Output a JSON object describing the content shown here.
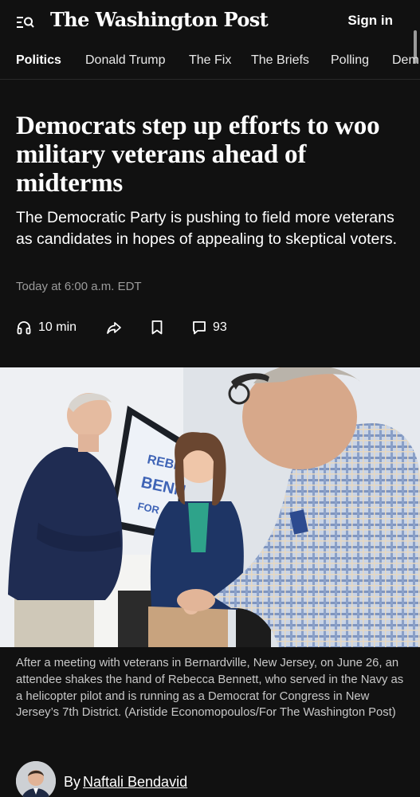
{
  "header": {
    "logo_text": "The Washington Post",
    "signin_label": "Sign in"
  },
  "nav": {
    "items": [
      {
        "label": "Politics",
        "active": true
      },
      {
        "label": "Donald Trump"
      },
      {
        "label": "The Fix"
      },
      {
        "label": "The Briefs"
      },
      {
        "label": "Polling"
      },
      {
        "label": "Dem"
      }
    ]
  },
  "article": {
    "headline": "Democrats step up efforts to woo military veterans ahead of midterms",
    "dek": "The Democratic Party is pushing to field more veterans as candidates in hopes of appealing to skeptical voters.",
    "timestamp": "Today at 6:00 a.m. EDT",
    "actions": {
      "listen_label": "10 min",
      "comments_count": "93"
    },
    "photo": {
      "sign_lines": [
        "REBE",
        "BENN",
        "FOR"
      ]
    },
    "caption": "After a meeting with veterans in Bernardville, New Jersey, on June 26, an attendee shakes the hand of Rebecca Bennett, who served in the Navy as a helicopter pilot and is running as a Democrat for Congress in New Jersey’s 7th District. (Aristide Economopoulos/For The Washington Post)",
    "byline": {
      "prefix": "By",
      "author": "Naftali Bendavid"
    }
  },
  "colors": {
    "background": "#111111",
    "text": "#ffffff",
    "muted": "#9b9b9b",
    "caption": "#c8c8c8"
  }
}
